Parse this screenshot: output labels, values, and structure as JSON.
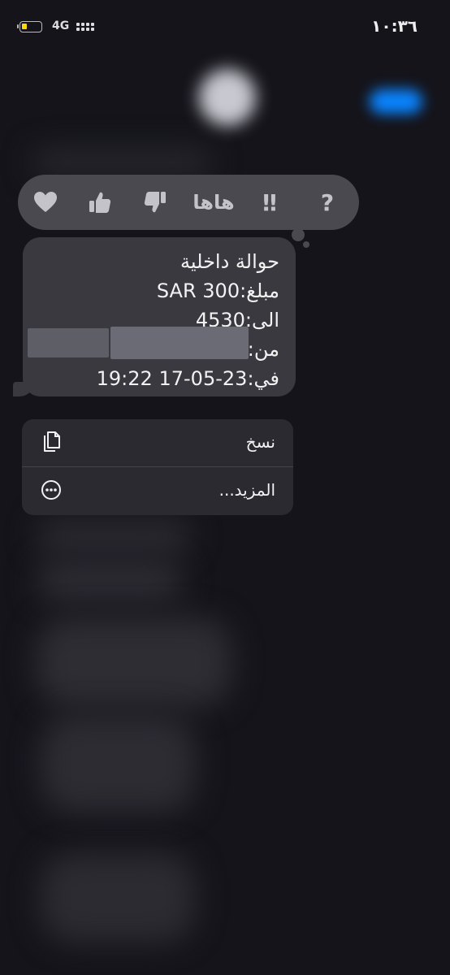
{
  "status_bar": {
    "time": "١٠:٣٦",
    "network": "4G"
  },
  "tapbacks": [
    {
      "name": "heart-icon"
    },
    {
      "name": "thumbs-up-icon"
    },
    {
      "name": "thumbs-down-icon"
    },
    {
      "name": "haha",
      "label": "هاها"
    },
    {
      "name": "exclamation-icon",
      "label": "‼"
    },
    {
      "name": "question-icon",
      "label": "?"
    }
  ],
  "message": {
    "line1": "حوالة داخلية",
    "line2": "مبلغ:300 SAR",
    "line3": "الى:4530",
    "line4": "من:",
    "line5": "في:23-05-17 19:22"
  },
  "context_menu": {
    "copy_label": "نسخ",
    "more_label": "المزيد..."
  },
  "colors": {
    "background": "#15141b",
    "tapback_bar": "#4a494f",
    "bubble": "#3a3940",
    "menu": "#2b2a30"
  }
}
